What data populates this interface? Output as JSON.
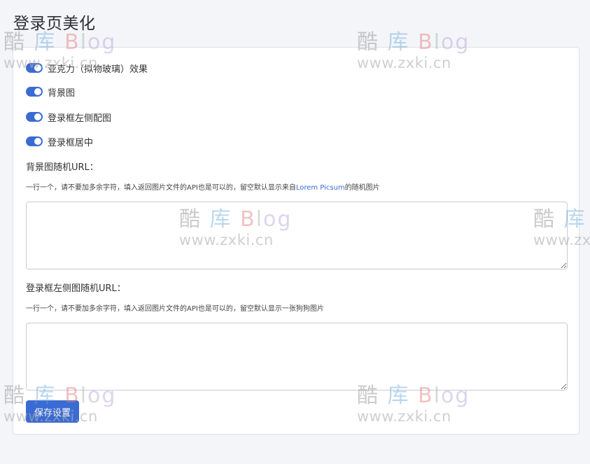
{
  "page": {
    "title": "登录页美化"
  },
  "switches": [
    {
      "label": "亚克力（拟物玻璃）效果",
      "checked": true
    },
    {
      "label": "背景图",
      "checked": true
    },
    {
      "label": "登录框左侧配图",
      "checked": true
    },
    {
      "label": "登录框居中",
      "checked": true
    }
  ],
  "bg_field": {
    "label": "背景图随机URL：",
    "hint_prefix": "一行一个，请不要加多余字符，填入返回图片文件的API也是可以的，留空默认显示来自",
    "hint_link": "Lorem Picsum",
    "hint_suffix": "的随机图片",
    "value": ""
  },
  "side_field": {
    "label": "登录框左侧图随机URL：",
    "hint": "一行一个，请不要加多余字符，填入返回图片文件的API也是可以的，留空默认显示一张狗狗图片",
    "value": ""
  },
  "actions": {
    "save_label": "保存设置"
  },
  "watermark": {
    "char1": "酷",
    "char2": "库",
    "b": "B",
    "l": "l",
    "og": "og",
    "url": "www.zxki.cn"
  },
  "colors": {
    "accent": "#3a6bd2",
    "background": "#f4f5f9",
    "card": "#ffffff",
    "border": "#dcdfe6"
  }
}
